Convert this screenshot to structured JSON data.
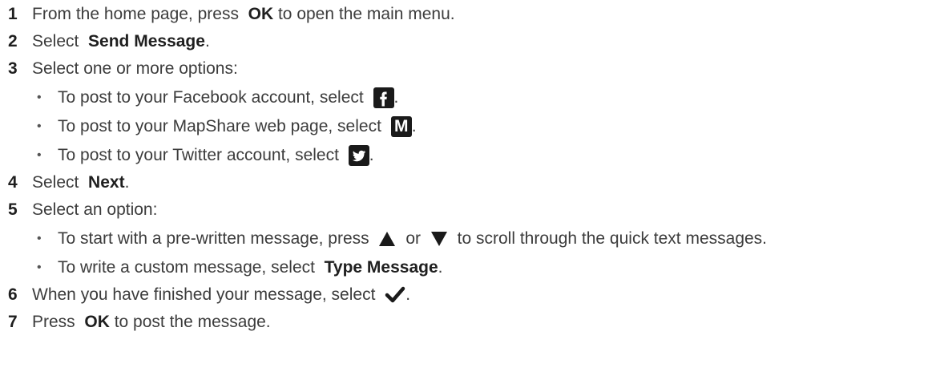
{
  "steps": [
    {
      "num": "1",
      "pre": "From the home page, press ",
      "bold": "OK",
      "post": " to open the main menu."
    },
    {
      "num": "2",
      "pre": "Select ",
      "bold": "Send Message",
      "post": "."
    },
    {
      "num": "3",
      "text": "Select one or more options:",
      "options": [
        {
          "bullet": "•",
          "text": "To post to your Facebook account, select ",
          "icon": "facebook-icon",
          "post": "."
        },
        {
          "bullet": "•",
          "text": "To post to your MapShare web page, select ",
          "icon": "mapshare-icon",
          "post": "."
        },
        {
          "bullet": "•",
          "text": "To post to your Twitter account, select ",
          "icon": "twitter-icon",
          "post": "."
        }
      ]
    },
    {
      "num": "4",
      "pre": "Select ",
      "bold": "Next",
      "post": "."
    },
    {
      "num": "5",
      "text": "Select an option:",
      "options": [
        {
          "bullet": "•",
          "pre": "To start with a pre-written message, press ",
          "mid": " or ",
          "post": " to scroll through the quick text messages."
        },
        {
          "bullet": "•",
          "pre": "To write a custom message, select ",
          "bold": "Type Message",
          "post": "."
        }
      ]
    },
    {
      "num": "6",
      "pre": "When you have finished your message, select ",
      "icon": "checkmark-icon",
      "post": "."
    },
    {
      "num": "7",
      "pre": "Press ",
      "bold": "OK",
      "post": " to post the message."
    }
  ],
  "icons": {
    "mapshare_letter": "M"
  },
  "colors": {
    "text": "#3c3c3c",
    "bold": "#1f1f1f",
    "icon_bg": "#1a1a1a"
  }
}
